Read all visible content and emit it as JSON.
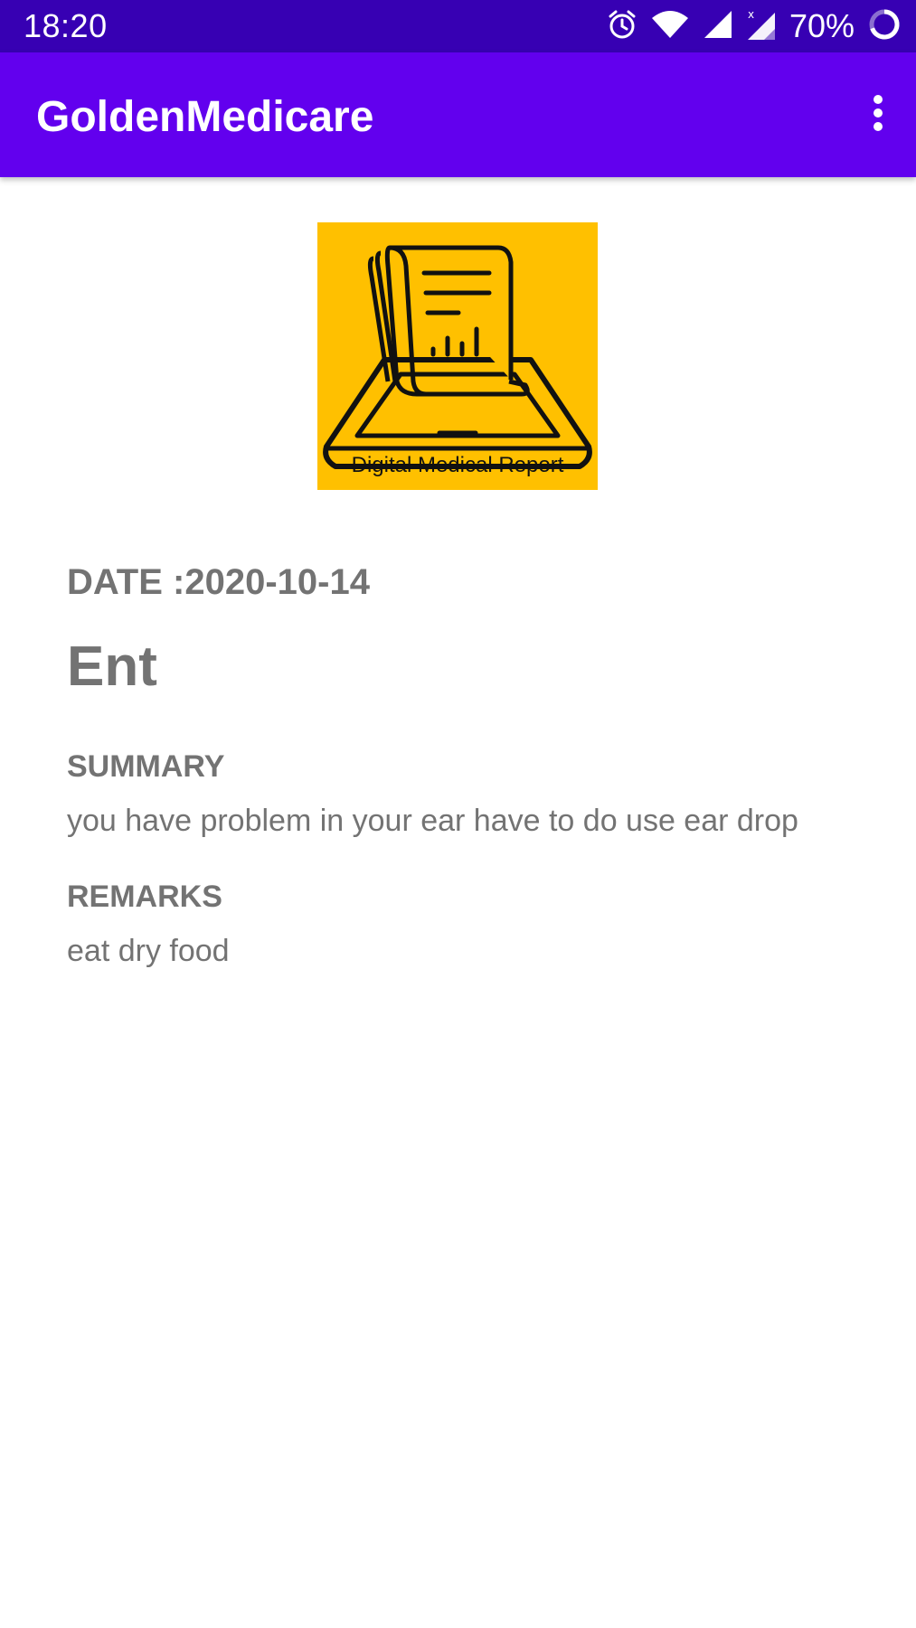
{
  "status_bar": {
    "time": "18:20",
    "battery_percent": "70%",
    "icons": [
      "alarm-icon",
      "wifi-icon",
      "signal-icon",
      "signal-no-data-icon",
      "battery-ring-icon"
    ]
  },
  "app_bar": {
    "title": "GoldenMedicare",
    "overflow_icon": "more-vert-icon"
  },
  "report": {
    "image_caption": "Digital Medical Report",
    "image_background": "#ffc000",
    "date_label": "DATE :",
    "date_value": "2020-10-14",
    "department": "Ent",
    "summary_label": "SUMMARY",
    "summary_text": "you have problem in your ear have to do use ear drop",
    "remarks_label": "REMARKS",
    "remarks_text": "eat dry food"
  },
  "colors": {
    "status_bar": "#3700b3",
    "app_bar": "#6200ee",
    "text_gray": "#737373"
  }
}
